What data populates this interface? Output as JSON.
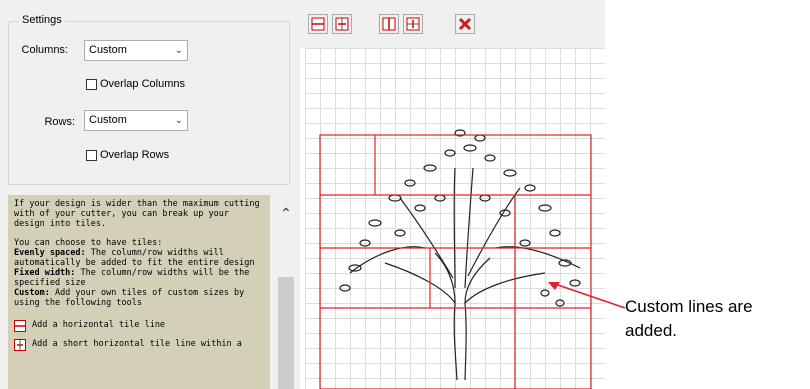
{
  "settings": {
    "title": "Settings",
    "columns": {
      "label": "Columns:",
      "value": "Custom",
      "overlap_label": "Overlap Columns",
      "overlap_checked": false
    },
    "rows": {
      "label": "Rows:",
      "value": "Custom",
      "overlap_label": "Overlap Rows",
      "overlap_checked": false
    }
  },
  "help": {
    "intro": "If your design is wider than the maximum cutting with of your cutter, you can break up your design into tiles.",
    "choose": "You can choose to have tiles:",
    "evenly_term": "Evenly spaced:",
    "evenly_desc": " The column/row widths will automatically be added to fit the entire design",
    "fixed_term": "Fixed width:",
    "fixed_desc": " The column/row widths will be the specified size",
    "custom_term": "Custom:",
    "custom_desc": " Add your own tiles of custom sizes by using the following tools",
    "tool1": "Add a horizontal tile line",
    "tool2": "Add a short horizontal tile line within a"
  },
  "toolbar": {
    "buttons": [
      "add-horizontal-line",
      "add-short-horizontal-line",
      "add-vertical-line",
      "add-short-vertical-line",
      "delete-line"
    ]
  },
  "annotation": {
    "line1": "Custom lines are",
    "line2": "added."
  },
  "colors": {
    "tile_line": "#e0202a",
    "help_bg": "#d4d0b8",
    "panel_bg": "#f0f0f0"
  }
}
